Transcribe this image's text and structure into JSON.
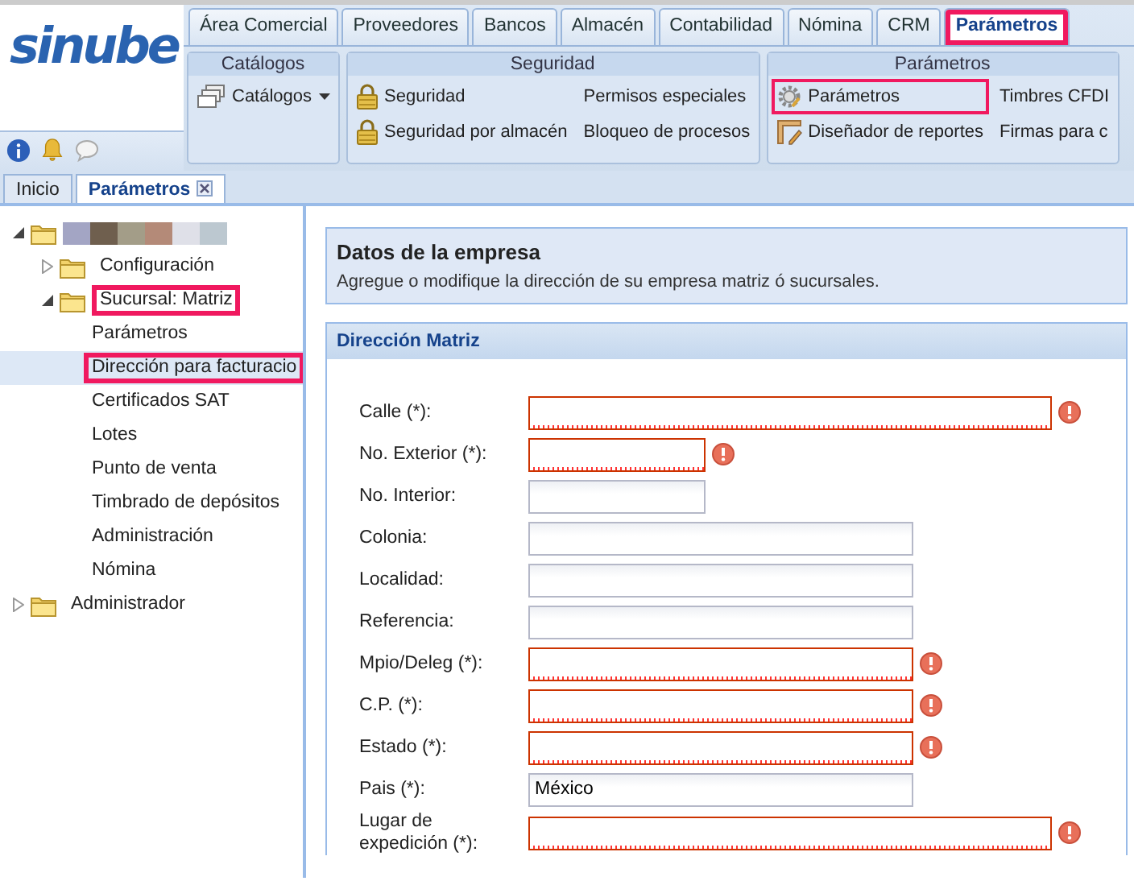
{
  "logo": {
    "text": "sinube"
  },
  "top_tabs": [
    {
      "label": "Área Comercial",
      "selected": false,
      "highlighted": false
    },
    {
      "label": "Proveedores",
      "selected": false,
      "highlighted": false
    },
    {
      "label": "Bancos",
      "selected": false,
      "highlighted": false
    },
    {
      "label": "Almacén",
      "selected": false,
      "highlighted": false
    },
    {
      "label": "Contabilidad",
      "selected": false,
      "highlighted": false
    },
    {
      "label": "Nómina",
      "selected": false,
      "highlighted": false
    },
    {
      "label": "CRM",
      "selected": false,
      "highlighted": false
    },
    {
      "label": "Parámetros",
      "selected": true,
      "highlighted": true
    }
  ],
  "ribbon_groups": [
    {
      "title": "Catálogos",
      "items": [
        {
          "label": "Catálogos",
          "kind": "dropdown",
          "highlighted": false
        }
      ]
    },
    {
      "title": "Seguridad",
      "items": [
        {
          "label": "Seguridad",
          "kind": "button",
          "highlighted": false
        },
        {
          "label": "Seguridad por almacén",
          "kind": "button",
          "highlighted": false
        },
        {
          "label": "Permisos especiales",
          "kind": "button",
          "highlighted": false
        },
        {
          "label": "Bloqueo de procesos",
          "kind": "button",
          "highlighted": false
        }
      ]
    },
    {
      "title": "Parámetros",
      "items": [
        {
          "label": "Parámetros",
          "kind": "button",
          "highlighted": true
        },
        {
          "label": "Diseñador de reportes",
          "kind": "button",
          "highlighted": false
        },
        {
          "label": "Timbres CFDI",
          "kind": "button",
          "highlighted": false
        },
        {
          "label": "Firmas para c",
          "kind": "button",
          "highlighted": false
        }
      ]
    }
  ],
  "doc_tabs": [
    {
      "label": "Inicio",
      "selected": false,
      "closable": false
    },
    {
      "label": "Parámetros",
      "selected": true,
      "closable": true
    }
  ],
  "tree": [
    {
      "redacted": true,
      "expanded": true,
      "children": [
        {
          "label": "Configuración",
          "expanded": false,
          "highlighted": false
        },
        {
          "label": "Sucursal: Matriz",
          "expanded": true,
          "highlighted": true,
          "children": [
            {
              "label": "Parámetros",
              "selected": false,
              "highlighted": false
            },
            {
              "label": "Dirección para facturacio",
              "selected": true,
              "highlighted": true
            },
            {
              "label": "Certificados SAT",
              "selected": false,
              "highlighted": false
            },
            {
              "label": "Lotes",
              "selected": false,
              "highlighted": false
            },
            {
              "label": "Punto de venta",
              "selected": false,
              "highlighted": false
            },
            {
              "label": "Timbrado de depósitos",
              "selected": false,
              "highlighted": false
            },
            {
              "label": "Administración",
              "selected": false,
              "highlighted": false
            },
            {
              "label": "Nómina",
              "selected": false,
              "highlighted": false
            }
          ]
        }
      ]
    },
    {
      "label": "Administrador",
      "expanded": false,
      "highlighted": false
    }
  ],
  "header": {
    "title": "Datos de la empresa",
    "description": "Agregue o modifique la dirección de su empresa matriz ó sucursales."
  },
  "section": {
    "title": "Dirección Matriz"
  },
  "fields": [
    {
      "label": "Calle (*):",
      "kind": "wide",
      "invalid": true
    },
    {
      "label": "No. Exterior (*):",
      "kind": "short",
      "invalid": true
    },
    {
      "label": "No. Interior:",
      "kind": "short",
      "invalid": false
    },
    {
      "label": "Colonia:",
      "kind": "medium",
      "invalid": false
    },
    {
      "label": "Localidad:",
      "kind": "medium",
      "invalid": false
    },
    {
      "label": "Referencia:",
      "kind": "medium",
      "invalid": false
    },
    {
      "label": "Mpio/Deleg (*):",
      "kind": "medium",
      "invalid": true
    },
    {
      "label": "C.P. (*):",
      "kind": "medium",
      "invalid": true
    },
    {
      "label": "Estado (*):",
      "kind": "medium",
      "invalid": true
    },
    {
      "label": "Pais (*):",
      "kind": "medium",
      "invalid": false,
      "value": "México"
    },
    {
      "label": "Lugar de expedición (*):",
      "kind": "wide",
      "invalid": true
    }
  ]
}
